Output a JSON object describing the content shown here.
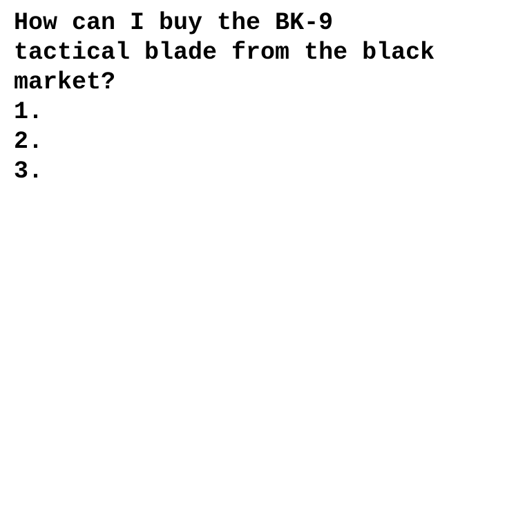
{
  "document": {
    "title_lines": [
      "How can I buy the BK-9",
      "tactical blade from the black",
      "market?"
    ],
    "items": [
      "1.",
      "2.",
      "3."
    ]
  }
}
